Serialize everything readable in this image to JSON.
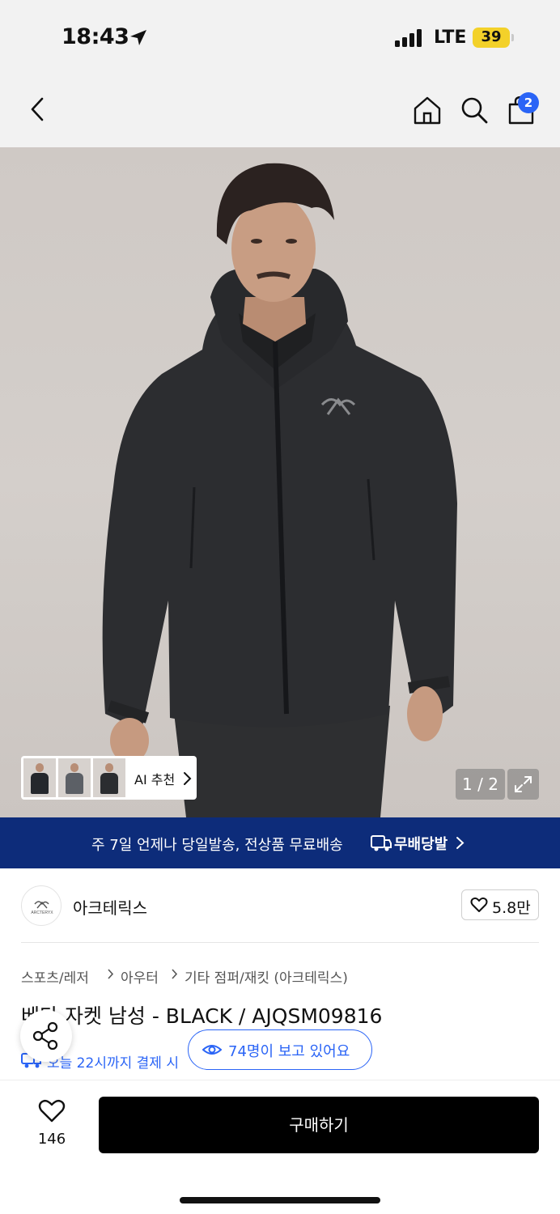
{
  "status_bar": {
    "time": "18:43",
    "network": "LTE",
    "battery": "39"
  },
  "nav": {
    "cart_count": "2"
  },
  "gallery": {
    "ai_label": "AI 추천",
    "page_indicator": "1 / 2",
    "thumbnails": [
      {
        "color": "#24272c"
      },
      {
        "color": "#5c6066"
      },
      {
        "color": "#2b2d30"
      }
    ]
  },
  "banner": {
    "text": "주 7일 언제나 당일발송, 전상품 무료배송",
    "logo": "무배당발"
  },
  "brand": {
    "name": "아크테릭스",
    "likes": "5.8만",
    "logo_text": "ARCTERYX"
  },
  "breadcrumb": [
    "스포츠/레저",
    "아우터",
    "기타 점퍼/재킷 (아크테릭스)"
  ],
  "product": {
    "title": "베타 자켓 남성 - BLACK / AJQSM09816",
    "delivery": "오늘 22시까지 결제 시"
  },
  "viewers": {
    "text": "74명이 보고 있어요"
  },
  "bottom": {
    "wish_count": "146",
    "buy_label": "구매하기"
  },
  "colors": {
    "accent": "#2a64f6",
    "banner_bg": "#0d2c7a",
    "buy_bg": "#000000",
    "battery": "#f3d12a"
  },
  "icons": [
    "location-arrow-icon",
    "signal-icon",
    "back-icon",
    "home-icon",
    "search-icon",
    "cart-icon",
    "chevron-right-icon",
    "expand-icon",
    "truck-icon",
    "heart-icon",
    "share-icon",
    "eye-icon"
  ]
}
